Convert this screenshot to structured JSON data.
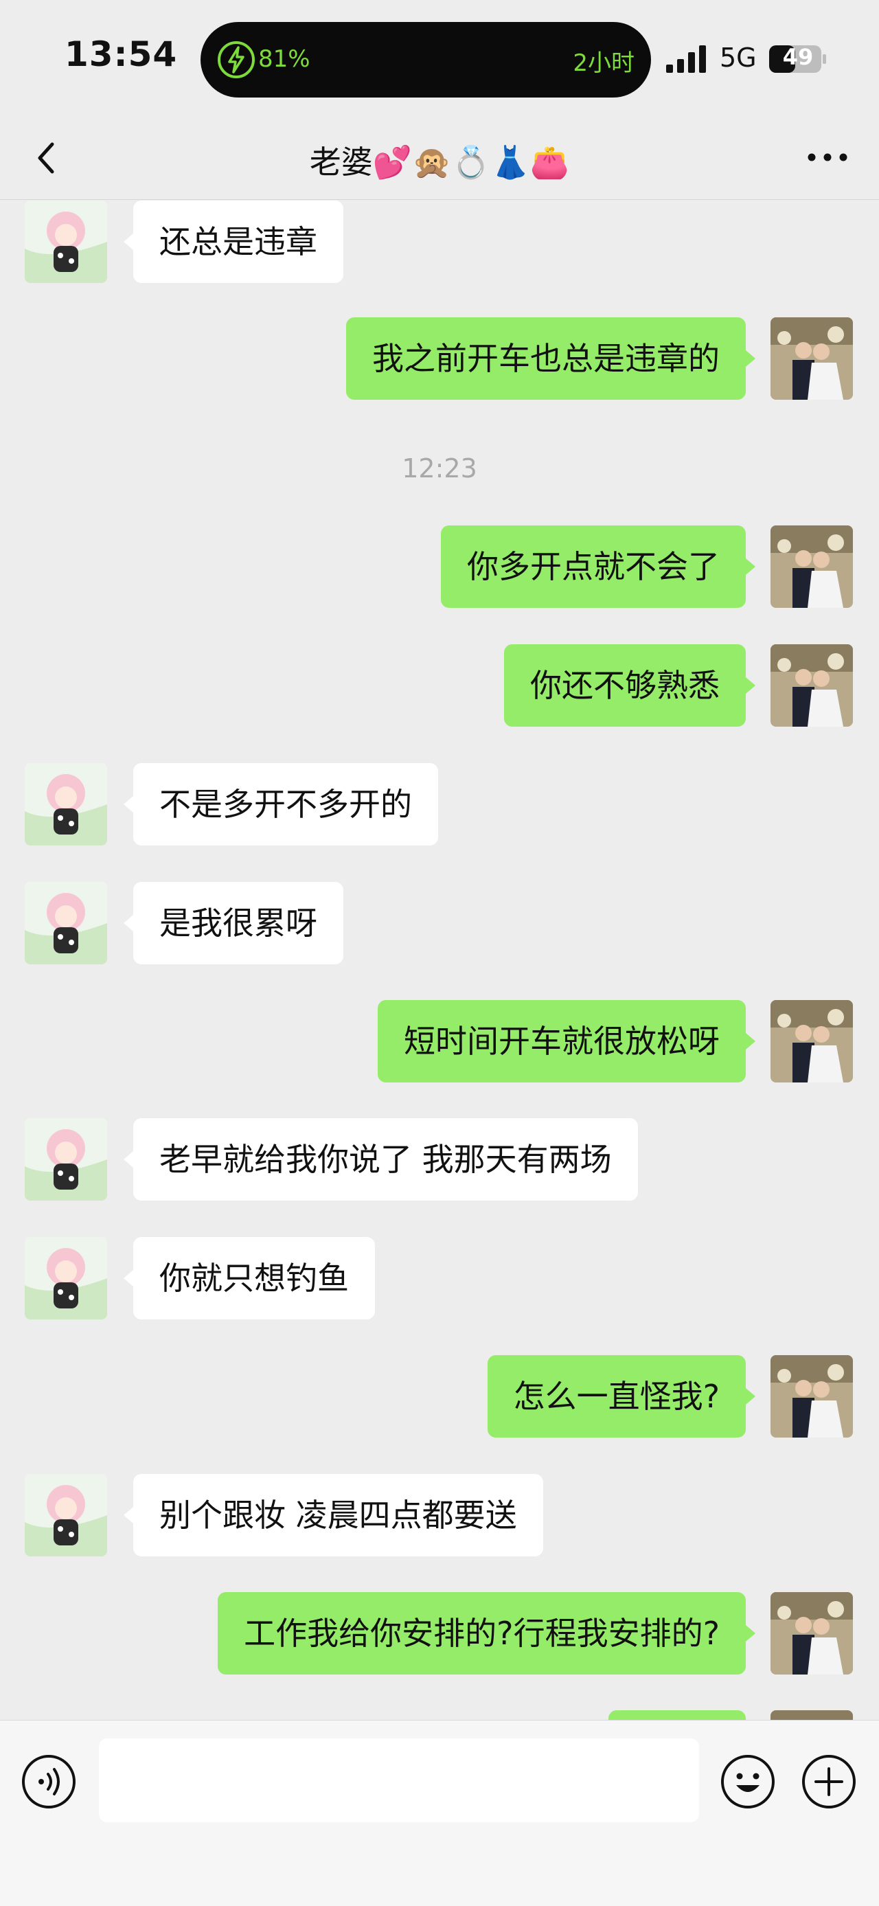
{
  "status_bar": {
    "time": "13:54",
    "battery_percent": "81%",
    "remaining_time": "2小时",
    "network": "5G",
    "battery_level": "49",
    "colors": {
      "island_text": "#7ddb3b"
    }
  },
  "chat": {
    "title": "老婆💕🙊💍👗👛",
    "accent_outgoing": "#95ec69",
    "incoming_bg": "#ffffff"
  },
  "messages": [
    {
      "side": "left",
      "text": "还总是违章"
    },
    {
      "side": "right",
      "text": "我之前开车也总是违章的"
    },
    {
      "timestamp": "12:23"
    },
    {
      "side": "right",
      "text": "你多开点就不会了"
    },
    {
      "side": "right",
      "text": "你还不够熟悉"
    },
    {
      "side": "left",
      "text": "不是多开不多开的"
    },
    {
      "side": "left",
      "text": "是我很累呀"
    },
    {
      "side": "right",
      "text": "短时间开车就很放松呀"
    },
    {
      "side": "left",
      "text": "老早就给我你说了 我那天有两场"
    },
    {
      "side": "left",
      "text": "你就只想钓鱼"
    },
    {
      "side": "right",
      "text": "怎么一直怪我?"
    },
    {
      "side": "left",
      "text": "别个跟妆 凌晨四点都要送"
    },
    {
      "side": "right",
      "text": "工作我给你安排的?行程我安排的?"
    },
    {
      "side": "right",
      "text": ""
    }
  ],
  "input_bar": {
    "icons": [
      "voice-icon",
      "emoji-icon",
      "plus-icon"
    ],
    "value": ""
  }
}
